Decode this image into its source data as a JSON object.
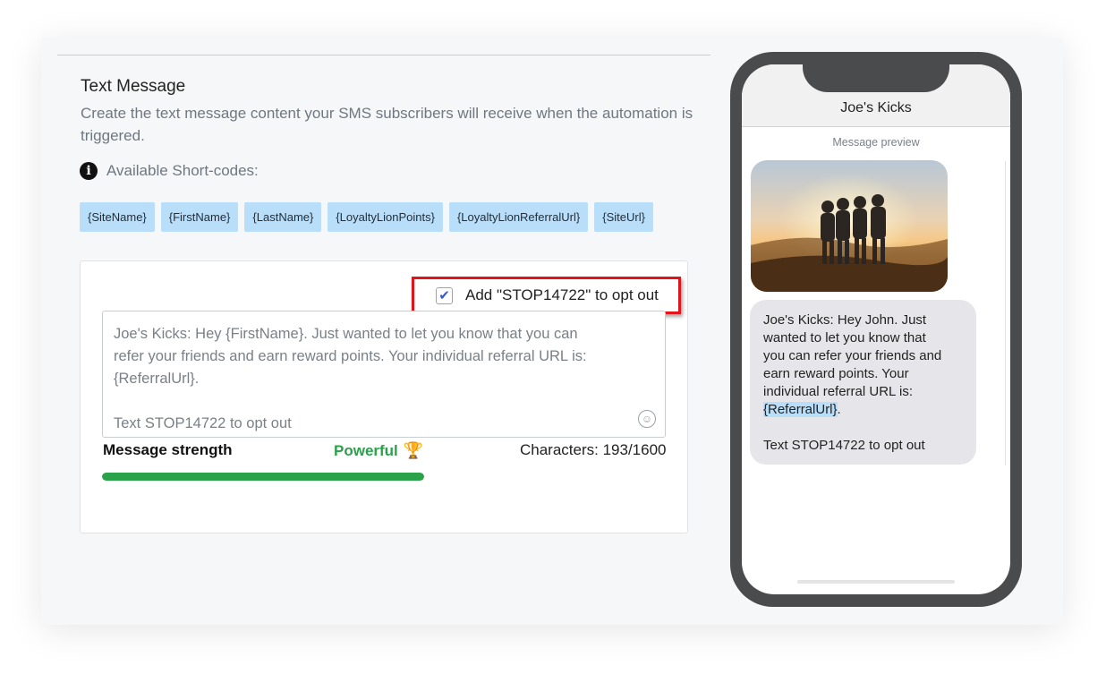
{
  "section": {
    "title": "Text Message",
    "description": "Create the text message content your SMS subscribers will receive when the automation is triggered."
  },
  "shortcodes": {
    "heading": "Available Short-codes:",
    "items": [
      "{SiteName}",
      "{FirstName}",
      "{LastName}",
      "{LoyaltyLionPoints}",
      "{LoyaltyLionReferralUrl}",
      "{SiteUrl}"
    ]
  },
  "optout": {
    "checked": true,
    "label": "Add \"STOP14722\" to opt out"
  },
  "message": {
    "lines": [
      "Joe's Kicks: Hey {FirstName}. Just wanted to let you know that you can",
      "refer your friends and earn reward points. Your individual referral URL is:",
      "{ReferralUrl}."
    ],
    "footer": "Text STOP14722 to opt out"
  },
  "strength": {
    "label": "Message strength",
    "value": "Powerful",
    "level": 0.5,
    "chars": "Characters: 193/1600"
  },
  "preview": {
    "contact": "Joe's Kicks",
    "label": "Message preview",
    "bubble_lines": [
      "Joe's Kicks: Hey John. Just",
      "wanted to let you know that",
      "you can refer your friends and",
      "earn reward points. Your",
      "individual referral URL is:"
    ],
    "referral": "{ReferralUrl}",
    "referral_suffix": ".",
    "footer": "Text STOP14722 to opt out"
  },
  "colors": {
    "accent_green": "#2aa24a",
    "chip_blue": "#b9defa",
    "highlight_red": "#e0141a"
  }
}
